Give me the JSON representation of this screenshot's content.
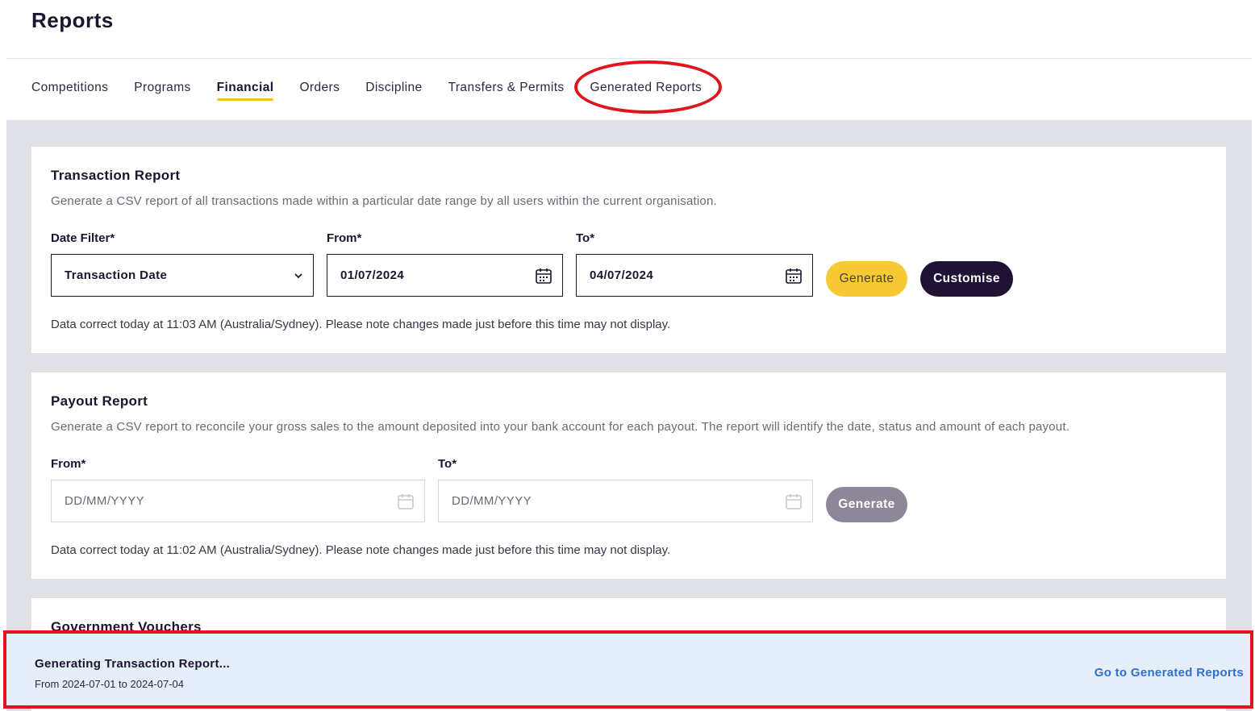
{
  "header": {
    "title": "Reports"
  },
  "tabs": [
    {
      "label": "Competitions"
    },
    {
      "label": "Programs"
    },
    {
      "label": "Financial"
    },
    {
      "label": "Orders"
    },
    {
      "label": "Discipline"
    },
    {
      "label": "Transfers & Permits"
    },
    {
      "label": "Generated Reports"
    }
  ],
  "active_tab": "Financial",
  "accent_color": "#f5c518",
  "highlight_color": "#e0141b",
  "transaction_report": {
    "title": "Transaction Report",
    "description": "Generate a CSV report of all transactions made within a particular date range by all users within the current organisation.",
    "date_filter_label": "Date Filter*",
    "date_filter_value": "Transaction Date",
    "from_label": "From*",
    "from_value": "01/07/2024",
    "to_label": "To*",
    "to_value": "04/07/2024",
    "generate_label": "Generate",
    "customise_label": "Customise",
    "note": "Data correct today at 11:03 AM (Australia/Sydney). Please note changes made just before this time may not display."
  },
  "payout_report": {
    "title": "Payout Report",
    "description": "Generate a CSV report to reconcile your gross sales to the amount deposited into your bank account for each payout. The report will identify the date, status and amount of each payout.",
    "from_label": "From*",
    "from_placeholder": "DD/MM/YYYY",
    "to_label": "To*",
    "to_placeholder": "DD/MM/YYYY",
    "generate_label": "Generate",
    "note": "Data correct today at 11:02 AM (Australia/Sydney). Please note changes made just before this time may not display."
  },
  "government_vouchers": {
    "title": "Government Vouchers"
  },
  "banner": {
    "title": "Generating Transaction Report...",
    "subtitle": "From 2024-07-01 to 2024-07-04",
    "link_label": "Go to Generated Reports"
  }
}
